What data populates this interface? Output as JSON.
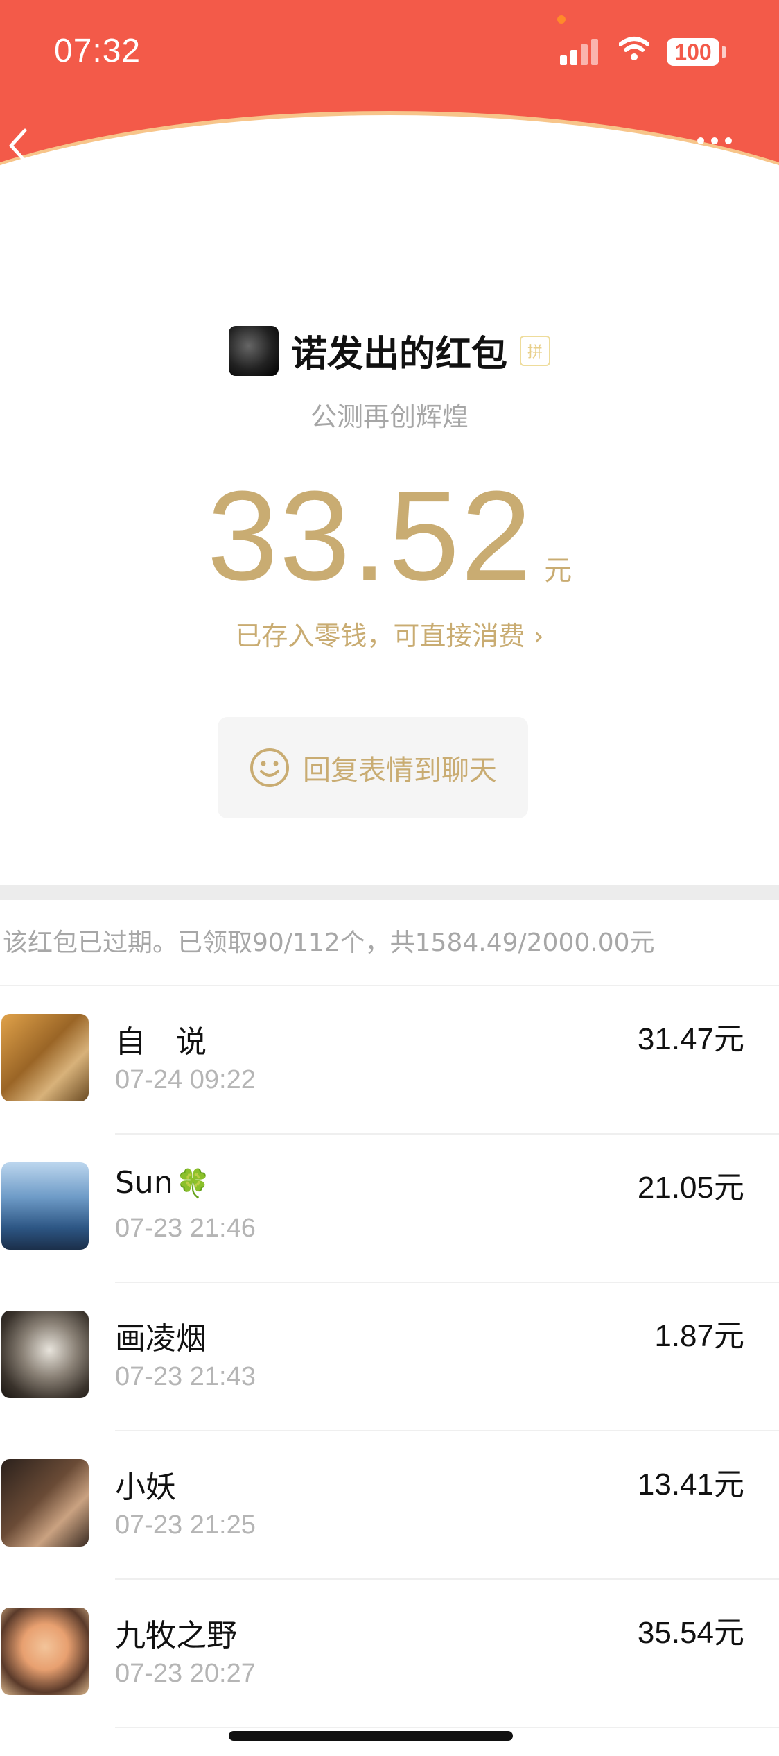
{
  "status_bar": {
    "time": "07:32",
    "battery": "100"
  },
  "header": {
    "back_icon": "chevron-left-icon",
    "more_icon": "more-dots-icon"
  },
  "envelope": {
    "sender_title": "诺发出的红包",
    "badge": "拼",
    "blessing": "公测再创辉煌",
    "amount": "33.52",
    "unit": "元",
    "stored_link": "已存入零钱，可直接消费 ›",
    "reply_label": "回复表情到聊天"
  },
  "summary": "该红包已过期。已领取90/112个，共1584.49/2000.00元",
  "records": [
    {
      "name": "自　说",
      "time": "07-24 09:22",
      "amount": "31.47元"
    },
    {
      "name": "Sun",
      "emoji": "🍀",
      "time": "07-23 21:46",
      "amount": "21.05元"
    },
    {
      "name": "画凌烟",
      "time": "07-23 21:43",
      "amount": "1.87元"
    },
    {
      "name": "小妖",
      "time": "07-23 21:25",
      "amount": "13.41元"
    },
    {
      "name": "九牧之野",
      "time": "07-23 20:27",
      "amount": "35.54元"
    }
  ],
  "colors": {
    "header_red": "#f35a49",
    "gold": "#c9ac72"
  }
}
